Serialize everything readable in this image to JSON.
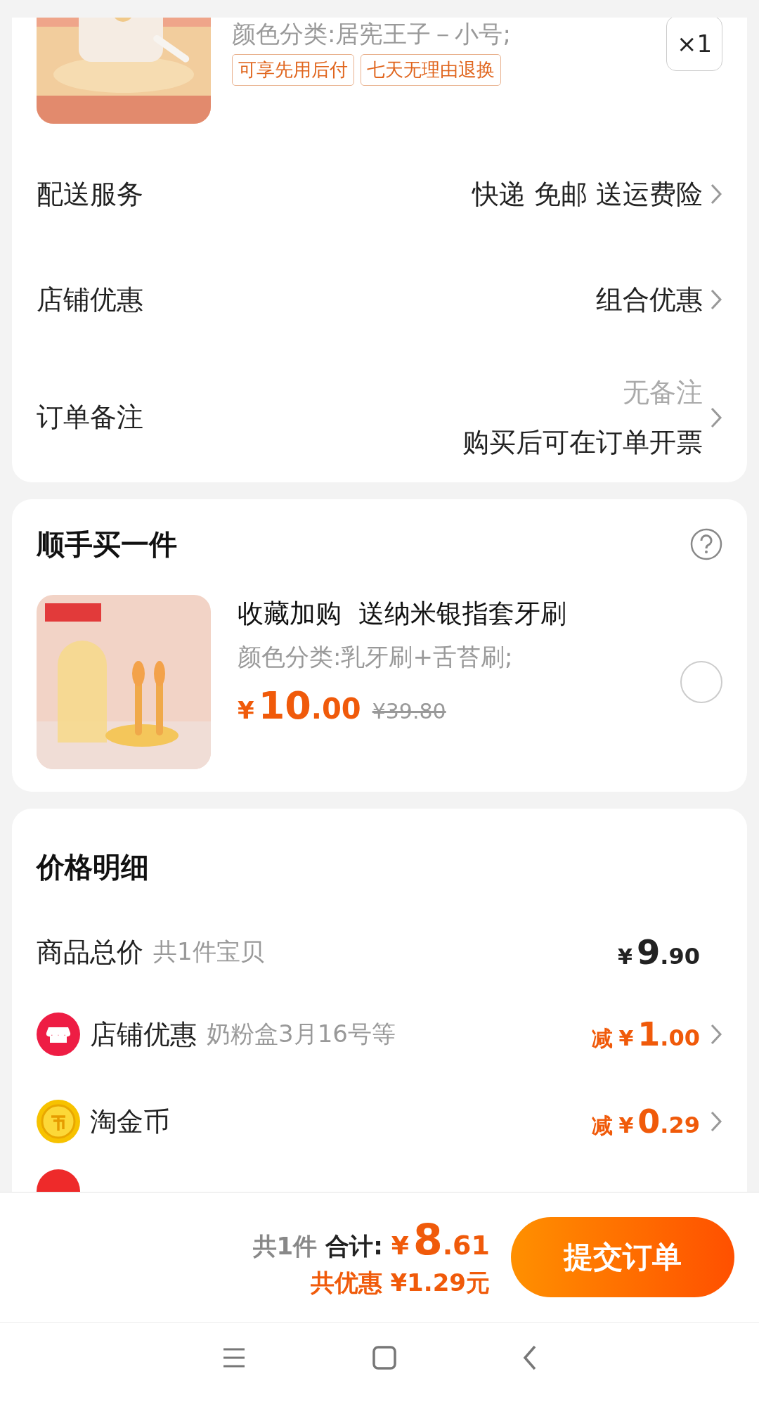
{
  "order_item": {
    "spec": "颜色分类:居宪王子－小号;",
    "tags": [
      "可享先用后付",
      "七天无理由退换"
    ],
    "quantity": "×1"
  },
  "options": [
    {
      "label": "配送服务",
      "value": "快递 免邮 送运费险"
    },
    {
      "label": "店铺优惠",
      "value": "组合优惠"
    },
    {
      "label": "订单备注",
      "hint": "无备注",
      "value": "购买后可在订单开票"
    }
  ],
  "add_on": {
    "title": "顺手买一件",
    "item": {
      "title": "收藏加购  送纳米银指套牙刷",
      "spec": "颜色分类:乳牙刷+舌苔刷;",
      "symbol": "¥",
      "int": "10",
      "dec": ".00",
      "original_price": "¥39.80",
      "selected": false
    }
  },
  "price_details": {
    "title": "价格明细",
    "rows": [
      {
        "kind": "total",
        "label": "商品总价",
        "note": "共1件宝贝",
        "symbol": "¥",
        "int": "9",
        "dec": ".90"
      },
      {
        "kind": "shop",
        "label": "店铺优惠",
        "note": "奶粉盒3月16号等",
        "prefix": "减",
        "symbol": "¥",
        "int": "1",
        "dec": ".00"
      },
      {
        "kind": "coin",
        "label": "淘金币",
        "prefix": "减",
        "symbol": "¥",
        "int": "0",
        "dec": ".29"
      }
    ]
  },
  "checkout": {
    "count": "共1件",
    "total_label": "合计:",
    "symbol": "¥",
    "int": "8",
    "dec": ".61",
    "savings": "共优惠 ¥1.29元",
    "submit": "提交订单"
  }
}
